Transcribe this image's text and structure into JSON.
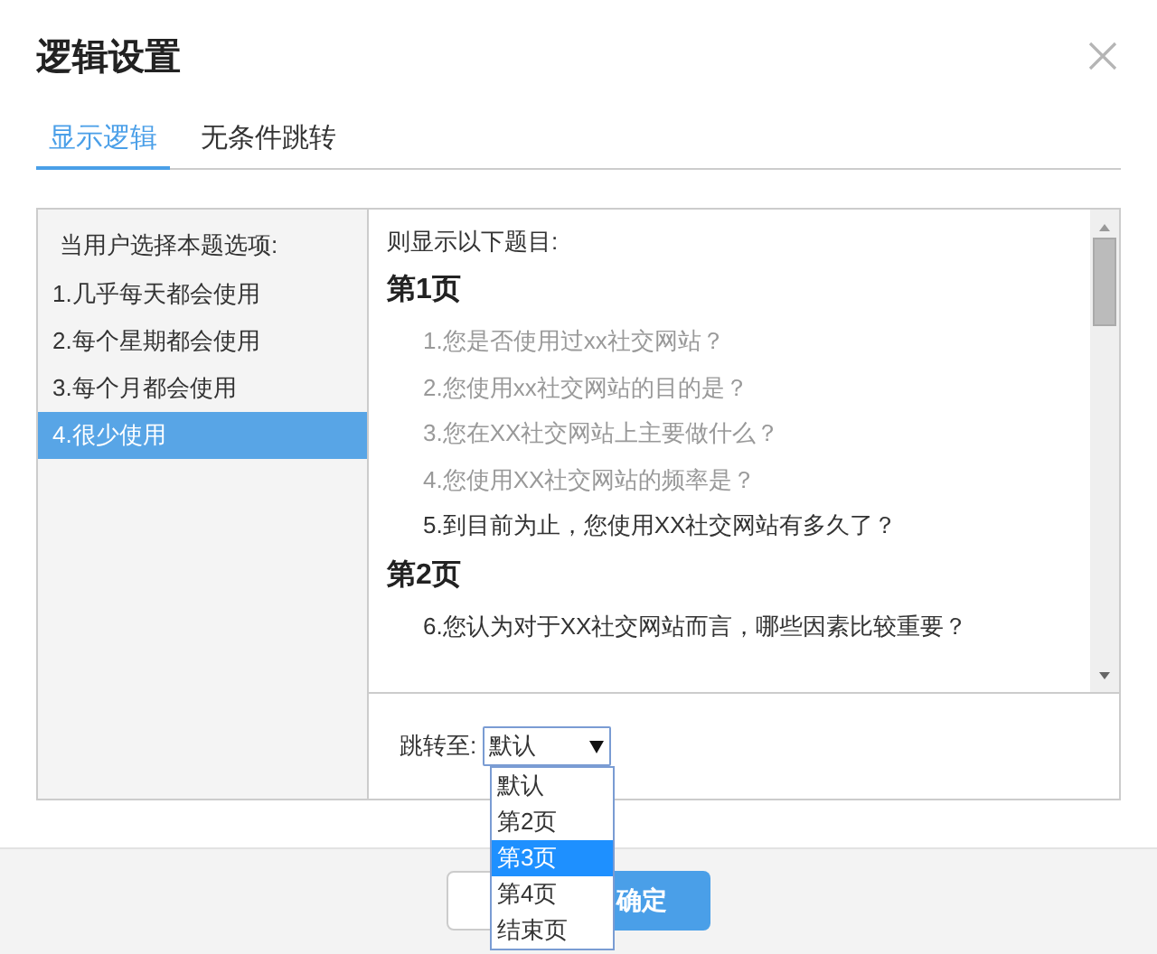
{
  "dialog": {
    "title": "逻辑设置"
  },
  "tabs": [
    {
      "label": "显示逻辑",
      "selected": true
    },
    {
      "label": "无条件跳转",
      "selected": false
    }
  ],
  "options_panel": {
    "heading": "当用户选择本题选项:",
    "options": [
      {
        "label": "1.几乎每天都会使用",
        "selected": false
      },
      {
        "label": "2.每个星期都会使用",
        "selected": false
      },
      {
        "label": "3.每个月都会使用",
        "selected": false
      },
      {
        "label": "4.很少使用",
        "selected": true
      }
    ]
  },
  "questions_panel": {
    "heading": "则显示以下题目:",
    "pages": [
      {
        "title": "第1页",
        "questions": [
          {
            "text": "1.您是否使用过xx社交网站？",
            "disabled": true
          },
          {
            "text": "2.您使用xx社交网站的目的是？",
            "disabled": true
          },
          {
            "text": "3.您在XX社交网站上主要做什么？",
            "disabled": true
          },
          {
            "text": "4.您使用XX社交网站的频率是？",
            "disabled": true
          },
          {
            "text": "5.到目前为止，您使用XX社交网站有多久了？",
            "disabled": false
          }
        ]
      },
      {
        "title": "第2页",
        "questions": [
          {
            "text": "6.您认为对于XX社交网站而言，哪些因素比较重要？",
            "disabled": false
          }
        ]
      }
    ]
  },
  "jump": {
    "label": "跳转至:",
    "value": "默认",
    "expanded": true,
    "options": [
      {
        "label": "默认",
        "highlighted": false
      },
      {
        "label": "第2页",
        "highlighted": false
      },
      {
        "label": "第3页",
        "highlighted": true
      },
      {
        "label": "第4页",
        "highlighted": false
      },
      {
        "label": "结束页",
        "highlighted": false
      }
    ]
  },
  "buttons": [
    {
      "kind": "secondary"
    },
    {
      "kind": "primary",
      "label": "确定"
    }
  ]
}
